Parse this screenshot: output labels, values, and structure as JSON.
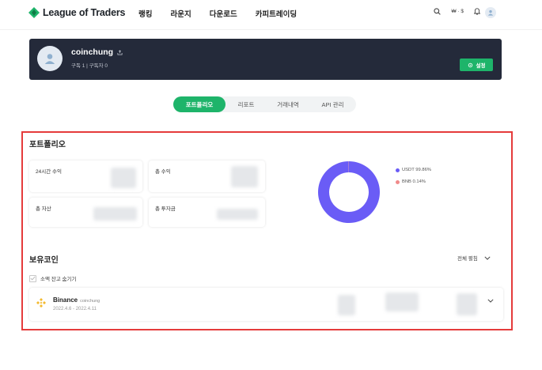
{
  "header": {
    "brand": "League of Traders",
    "nav": [
      "랭킹",
      "라운지",
      "다운로드",
      "카피트레이딩"
    ],
    "currency": "₩ · $"
  },
  "profile": {
    "username": "coinchung",
    "subscriptions": "구독 1  |  구독자 0",
    "settings_label": "설정"
  },
  "tabs": [
    {
      "label": "포트폴리오",
      "active": true
    },
    {
      "label": "리포트",
      "active": false
    },
    {
      "label": "거래내역",
      "active": false
    },
    {
      "label": "API 관리",
      "active": false
    }
  ],
  "portfolio": {
    "title": "포트폴리오",
    "cards": [
      {
        "label": "24시간 수익"
      },
      {
        "label": "총 수익"
      },
      {
        "label": "총 자산"
      },
      {
        "label": "총 투자금"
      }
    ],
    "chart_data": {
      "type": "pie",
      "style": "donut",
      "categories": [
        "USDT",
        "BNB"
      ],
      "values": [
        99.86,
        0.14
      ],
      "legend": [
        "USDT 99.86%",
        "BNB 0.14%"
      ],
      "colors": [
        "#6a5cf6",
        "#f08a8a"
      ],
      "legend_position": "right"
    }
  },
  "holdings": {
    "title": "보유코인",
    "filter_label": "전체 펼침",
    "hide_small_label": "소액 잔고 숨기기",
    "rows": [
      {
        "exchange": "Binance",
        "account": "coinchung",
        "period": "2022.4.6 - 2022.4.11"
      }
    ]
  },
  "colors": {
    "accent": "#1eb46a",
    "banner": "#242a3a",
    "highlight": "#e53b3b"
  }
}
